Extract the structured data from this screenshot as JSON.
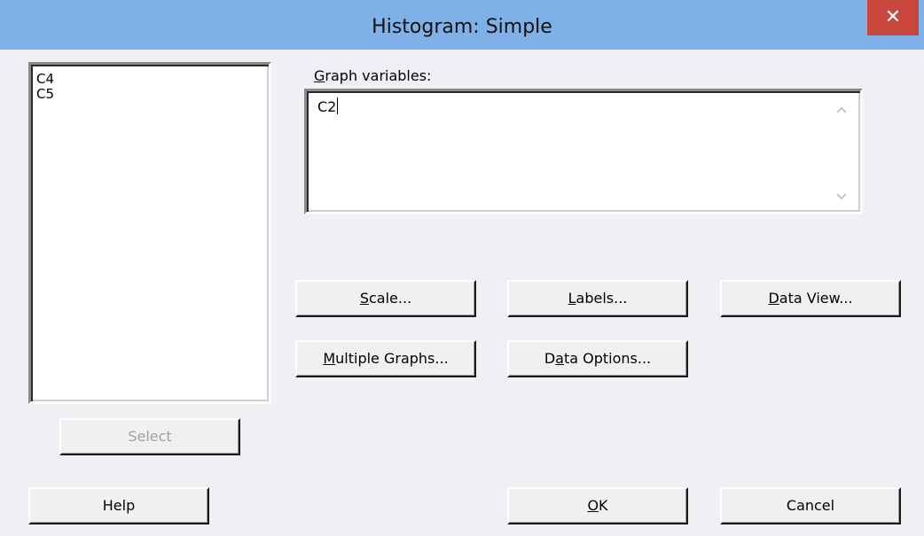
{
  "window": {
    "title": "Histogram: Simple",
    "close_glyph": "✕"
  },
  "variables": {
    "items": [
      "C4",
      "C5"
    ]
  },
  "graph_variables": {
    "label_hotkey": "G",
    "label_rest": "raph variables:",
    "value": "C2"
  },
  "buttons": {
    "scale": {
      "pre": "",
      "key": "S",
      "post": "cale..."
    },
    "labels": {
      "pre": "",
      "key": "L",
      "post": "abels..."
    },
    "data_view": {
      "pre": "",
      "key": "D",
      "post": "ata View..."
    },
    "multiple_graphs": {
      "pre": "",
      "key": "M",
      "post": "ultiple Graphs..."
    },
    "data_options": {
      "pre": "D",
      "key": "a",
      "post": "ta Options..."
    },
    "select": "Select",
    "help": "Help",
    "ok": {
      "pre": "",
      "key": "O",
      "post": "K"
    },
    "cancel": "Cancel"
  },
  "icons": {
    "scroll_up": "chevron-up-icon",
    "scroll_down": "chevron-down-icon",
    "close": "close-icon"
  },
  "colors": {
    "titlebar": "#7fb1e8",
    "close_button": "#c9463d",
    "dialog_bg": "#f0f0f0",
    "disabled_text": "#a0a0a0"
  }
}
